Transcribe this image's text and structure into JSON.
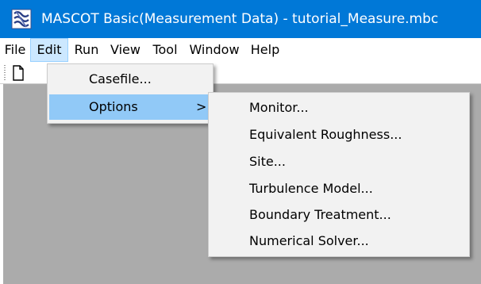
{
  "window": {
    "title": "MASCOT Basic(Measurement Data) - tutorial_Measure.mbc",
    "app_icon": "mascot-app-icon",
    "titlebar_color": "#0078d7"
  },
  "menubar": {
    "items": [
      {
        "label": "File"
      },
      {
        "label": "Edit",
        "active": true
      },
      {
        "label": "Run"
      },
      {
        "label": "View"
      },
      {
        "label": "Tool"
      },
      {
        "label": "Window"
      },
      {
        "label": "Help"
      }
    ]
  },
  "toolbar": {
    "new_icon": "new-document-icon"
  },
  "edit_menu": {
    "items": [
      {
        "label": "Casefile..."
      },
      {
        "label": "Options",
        "submenu_arrow": ">",
        "highlighted": true
      }
    ]
  },
  "options_submenu": {
    "items": [
      {
        "label": "Monitor..."
      },
      {
        "label": "Equivalent Roughness..."
      },
      {
        "label": "Site..."
      },
      {
        "label": "Turbulence Model..."
      },
      {
        "label": "Boundary Treatment..."
      },
      {
        "label": "Numerical Solver..."
      }
    ]
  },
  "colors": {
    "highlight": "#91c9f7",
    "menu_bg": "#f2f2f2",
    "client_bg": "#ababab",
    "active_menu": "#cce8ff"
  }
}
